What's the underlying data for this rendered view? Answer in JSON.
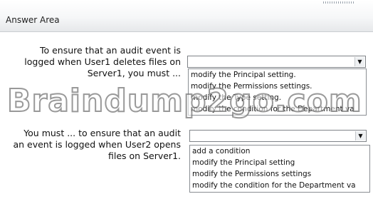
{
  "header": {
    "title": "Answer Area"
  },
  "questions": [
    {
      "text": "To ensure that an audit event is logged when User1 deletes files on Server1, you must ...",
      "options": [
        "modify the Principal setting.",
        "modify the Permissions settings.",
        "modify the Type setting.",
        "modify the condition for the Department va"
      ]
    },
    {
      "text": "You must ... to ensure that an audit an event is logged when User2 opens files on Server1.",
      "options": [
        "add a condition",
        "modify the Principal setting",
        "modify the Permissions settings",
        "modify the condition for the Department va"
      ]
    }
  ],
  "watermark": "Braindump2go.com",
  "icons": {
    "dropdown_arrow": "chevron-down-icon"
  }
}
